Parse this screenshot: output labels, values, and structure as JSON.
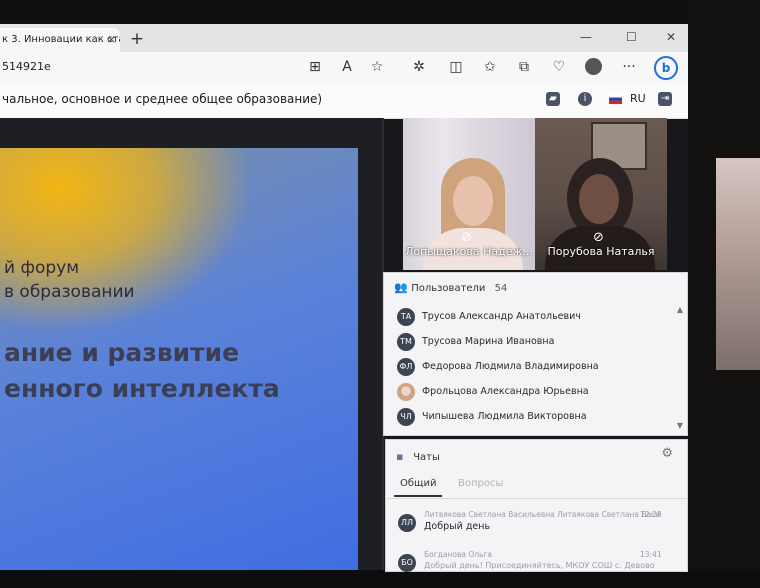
{
  "browser": {
    "tab_title": "к 3. Инновации как ста",
    "tab_close": "×",
    "new_tab": "+",
    "url_fragment": "514921e",
    "window_controls": [
      "—",
      "☐",
      "✕"
    ]
  },
  "page": {
    "title": "чальное, основное и среднее общее образование)",
    "language": "RU"
  },
  "slide": {
    "line1": "й форум",
    "line2": "в образовании",
    "line3": "ание и развитие",
    "line4": "енного интеллекта"
  },
  "videos": [
    {
      "name": "Лопыщакова Надеж..."
    },
    {
      "name": "Порубова Наталья"
    }
  ],
  "users_panel": {
    "title": "Пользователи",
    "count": "54",
    "users": [
      {
        "initials": "ТА",
        "name": "Трусов Александр Анатольевич"
      },
      {
        "initials": "ТМ",
        "name": "Трусова Марина Ивановна"
      },
      {
        "initials": "ФЛ",
        "name": "Федорова Людмила Владимировна"
      },
      {
        "initials": "",
        "name": "Фрольцова Александра Юрьевна"
      },
      {
        "initials": "ЧЛ",
        "name": "Чипышева Людмила Викторовна"
      }
    ]
  },
  "chats_panel": {
    "title": "Чаты",
    "tabs": [
      "Общий",
      "Вопросы"
    ],
    "messages": [
      {
        "initials": "ЛЛ",
        "author": "Литвякова Светлана Васильевна Литвякова Светлана Васи",
        "time": "12:28",
        "text": "Добрый день"
      },
      {
        "initials": "БО",
        "author": "Богданова Ольга",
        "time": "13:41",
        "text": "Добрый день! Присоединяйтесь, МКОУ СОШ с. Девово"
      }
    ]
  },
  "icons": {
    "users": "users-icon",
    "chat": "chat-icon",
    "gear": "gear-icon",
    "mic_muted": "mic-muted-icon"
  }
}
